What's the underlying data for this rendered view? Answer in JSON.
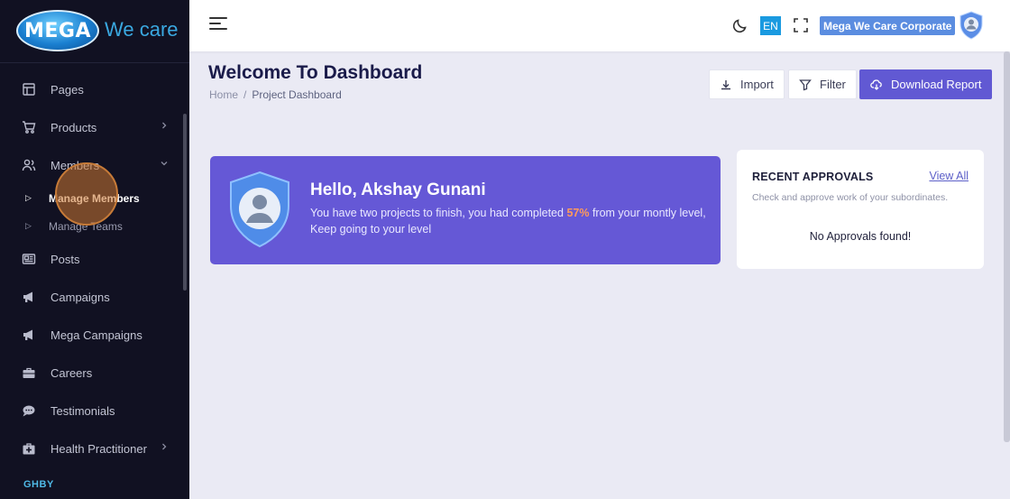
{
  "logo": {
    "mark": "MEGA",
    "tagline": "We care"
  },
  "sidebar": {
    "items": [
      {
        "label": "Pages",
        "icon": "layout-icon"
      },
      {
        "label": "Products",
        "icon": "cart-icon"
      },
      {
        "label": "Members",
        "icon": "users-icon"
      },
      {
        "label": "Posts",
        "icon": "newspaper-icon"
      },
      {
        "label": "Campaigns",
        "icon": "megaphone-icon"
      },
      {
        "label": "Mega Campaigns",
        "icon": "megaphone-icon"
      },
      {
        "label": "Careers",
        "icon": "briefcase-icon"
      },
      {
        "label": "Testimonials",
        "icon": "chat-icon"
      },
      {
        "label": "Health Practitioner",
        "icon": "medical-bag-icon"
      }
    ],
    "members_sub": [
      {
        "label": "Manage Members"
      },
      {
        "label": "Manage Teams"
      }
    ],
    "section_label": "GHBY"
  },
  "topbar": {
    "lang": "EN",
    "org": "Mega We Care Corporate"
  },
  "header": {
    "title": "Welcome To Dashboard",
    "breadcrumb_home": "Home",
    "breadcrumb_sep": "/",
    "breadcrumb_current": "Project Dashboard"
  },
  "actions": {
    "import": "Import",
    "filter": "Filter",
    "download": "Download Report"
  },
  "hello": {
    "greeting": "Hello, Akshay Gunani",
    "msg_before": "You have two projects to finish, you had completed ",
    "percent": "57%",
    "msg_after": " from your montly level, Keep going to your level"
  },
  "approvals": {
    "title": "RECENT APPROVALS",
    "view_all": "View All",
    "subtitle": "Check and approve work of your subordinates.",
    "empty": "No Approvals found!"
  },
  "colors": {
    "sidebar_bg": "#111122",
    "accent": "#6159d3",
    "highlight": "#ff9a5c",
    "lang_badge": "#1a9ae0",
    "org_badge": "#5b8de0"
  }
}
